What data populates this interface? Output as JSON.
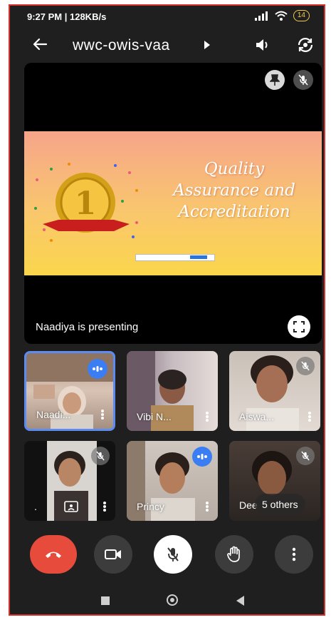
{
  "status_bar": {
    "time": "9:27 PM | 128KB/s",
    "battery": "14"
  },
  "app_bar": {
    "meeting_code": "wwc-owis-vaa"
  },
  "presentation": {
    "slide_title_lines": [
      "Quality",
      "Assurance and",
      "Accreditation"
    ],
    "medal_number": "1",
    "presenter_text": "Naadiya is presenting"
  },
  "participants": [
    {
      "name": "Naadi...",
      "state": "speaking"
    },
    {
      "name": "Vibi N...",
      "state": "unmuted"
    },
    {
      "name": "Aiswa...",
      "state": "muted"
    },
    {
      "name": ".",
      "state": "muted"
    },
    {
      "name": "Princy",
      "state": "speaking"
    },
    {
      "name": "Dee",
      "state": "muted"
    }
  ],
  "others_label": "5 others",
  "colors": {
    "end_call": "#e64b3c",
    "active_speaker": "#3b7ef3",
    "background": "#1f1f1f"
  },
  "controls": [
    "end-call-icon",
    "camera-icon",
    "mic-off-icon",
    "raise-hand-icon",
    "more-vert-icon"
  ]
}
